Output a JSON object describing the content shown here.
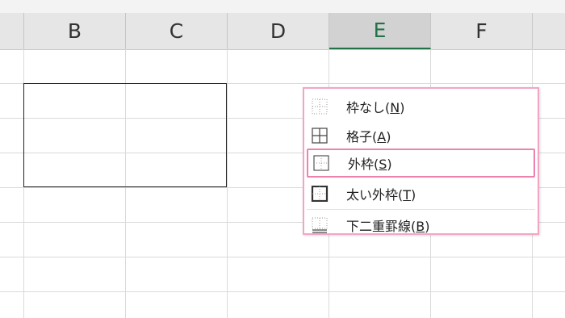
{
  "columns": [
    {
      "label": "B",
      "selected": false
    },
    {
      "label": "C",
      "selected": false
    },
    {
      "label": "D",
      "selected": false
    },
    {
      "label": "E",
      "selected": true
    },
    {
      "label": "F",
      "selected": false
    }
  ],
  "border_menu": {
    "items": [
      {
        "label": "枠なし(N)",
        "text": "枠なし(",
        "key": "N",
        "icon": "no-border-icon",
        "highlighted": false
      },
      {
        "label": "格子(A)",
        "text": "格子(",
        "key": "A",
        "icon": "all-borders-icon",
        "highlighted": false
      },
      {
        "label": "外枠(S)",
        "text": "外枠(",
        "key": "S",
        "icon": "outside-borders-icon",
        "highlighted": true
      },
      {
        "label": "太い外枠(T)",
        "text": "太い外枠(",
        "key": "T",
        "icon": "thick-outside-borders-icon",
        "highlighted": false
      },
      {
        "label": "下二重罫線(B)",
        "text": "下二重罫線(",
        "key": "B",
        "icon": "bottom-double-border-icon",
        "highlighted": false
      }
    ]
  },
  "colors": {
    "selected_column": "#217346",
    "menu_highlight": "#ec82ae"
  }
}
